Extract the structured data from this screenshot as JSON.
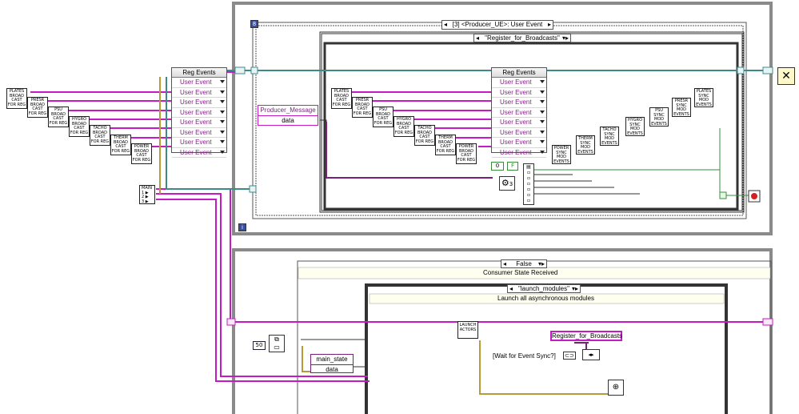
{
  "left_broadcast": {
    "nodes": [
      "PLATES\nBROAD\nCAST\nFOR REG",
      "PRESR\nBROAD\nCAST\nFOR REG",
      "PSU\nBROAD\nCAST\nFOR REG",
      "HYGRO\nBROAD\nCAST\nFOR REG",
      "TACHO\nBROAD\nCAST\nFOR REG",
      "THERM\nBROAD\nCAST\nFOR REG",
      "POWER\nBROAD\nCAST\nFOR REG"
    ]
  },
  "reg_events_outer": {
    "title": "Reg Events",
    "rows": [
      "User Event",
      "User Event",
      "User Event",
      "User Event",
      "User Event",
      "User Event",
      "User Event",
      "User Event"
    ]
  },
  "main_bundle": {
    "label": "MAIN\n1 ▶\n2 ▶\n3 ▶"
  },
  "event_loop": {
    "loop_marker": "8",
    "info_marker": "i",
    "event_selector": "[3] <Producer_UE>: User Event",
    "case_selector": "\"Register_for_Broadcasts\"",
    "producer_message": {
      "title": "Producer_Message",
      "field": "data"
    },
    "reg_events_inner": {
      "title": "Reg Events",
      "rows": [
        "User Event",
        "User Event",
        "User Event",
        "User Event",
        "User Event",
        "User Event",
        "User Event",
        "User Event"
      ]
    },
    "broadcast_nodes": [
      "PLATES\nBROAD\nCAST\nFOR REG",
      "PRESR\nBROAD\nCAST\nFOR REG",
      "PSU\nBROAD\nCAST\nFOR REG",
      "HYGRO\nBROAD\nCAST\nFOR REG",
      "TACHO\nBROAD\nCAST\nFOR REG",
      "THERM\nBROAD\nCAST\nFOR REG",
      "POWER\nBROAD\nCAST\nFOR REG"
    ],
    "sync_nodes": [
      "POWER\nSYNC\nMOD\nEVENTS",
      "THERM\nSYNC\nMOD\nEVENTS",
      "TACHO\nSYNC\nMOD\nEVENTS",
      "HYGRO\nSYNC\nMOD\nEVENTS",
      "PSU\nSYNC\nMOD\nEVENTS",
      "PRESR\nSYNC\nMOD\nEVENTS",
      "PLATES\nSYNC\nMOD\nEVENTS"
    ],
    "const_zero": "0",
    "const_f": "F",
    "const_three": "3"
  },
  "consumer_loop": {
    "case_selector": "False",
    "case_title": "Consumer State Received",
    "inner_selector": "\"launch_modules\"",
    "inner_title": "Launch all asynchronous modules",
    "constant_50": "50",
    "main_state": {
      "title": "main_state",
      "field": "data"
    },
    "launch_actors": "LAUNCH\nACTORS",
    "wait_label": "[Wait for Event Sync?]",
    "register_string": "Register_for_Broadcasts"
  },
  "colors": {
    "event_wire": "#c41bc4",
    "cluster_wire": "#3c8a8a",
    "error_wire": "#b79a3c",
    "refnum_wire": "#4a8a7a"
  }
}
